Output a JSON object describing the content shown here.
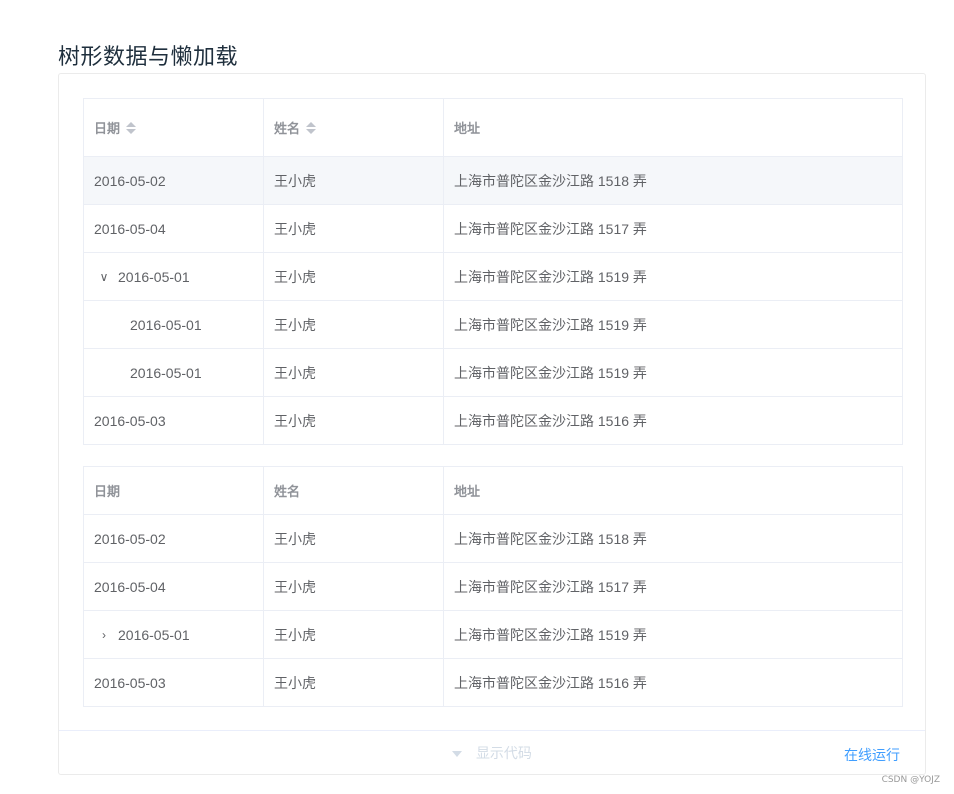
{
  "page": {
    "title": "树形数据与懒加载"
  },
  "table1": {
    "headers": {
      "date": "日期",
      "name": "姓名",
      "address": "地址"
    },
    "rows": [
      {
        "date": "2016-05-02",
        "name": "王小虎",
        "address": "上海市普陀区金沙江路 1518 弄"
      },
      {
        "date": "2016-05-04",
        "name": "王小虎",
        "address": "上海市普陀区金沙江路 1517 弄"
      },
      {
        "date": "2016-05-01",
        "name": "王小虎",
        "address": "上海市普陀区金沙江路 1519 弄",
        "expand_icon": "∨"
      },
      {
        "date": "2016-05-01",
        "name": "王小虎",
        "address": "上海市普陀区金沙江路 1519 弄"
      },
      {
        "date": "2016-05-01",
        "name": "王小虎",
        "address": "上海市普陀区金沙江路 1519 弄"
      },
      {
        "date": "2016-05-03",
        "name": "王小虎",
        "address": "上海市普陀区金沙江路 1516 弄"
      }
    ]
  },
  "table2": {
    "headers": {
      "date": "日期",
      "name": "姓名",
      "address": "地址"
    },
    "rows": [
      {
        "date": "2016-05-02",
        "name": "王小虎",
        "address": "上海市普陀区金沙江路 1518 弄"
      },
      {
        "date": "2016-05-04",
        "name": "王小虎",
        "address": "上海市普陀区金沙江路 1517 弄"
      },
      {
        "date": "2016-05-01",
        "name": "王小虎",
        "address": "上海市普陀区金沙江路 1519 弄",
        "expand_icon": "›"
      },
      {
        "date": "2016-05-03",
        "name": "王小虎",
        "address": "上海市普陀区金沙江路 1516 弄"
      }
    ]
  },
  "footer": {
    "show_code": "显示代码",
    "run_online": "在线运行"
  },
  "watermark": "CSDN @YOJZ",
  "colors": {
    "accent": "#409eff",
    "header_text": "#909399",
    "body_text": "#606266",
    "border": "#ebeef5",
    "hover_row": "#f5f7fa"
  }
}
